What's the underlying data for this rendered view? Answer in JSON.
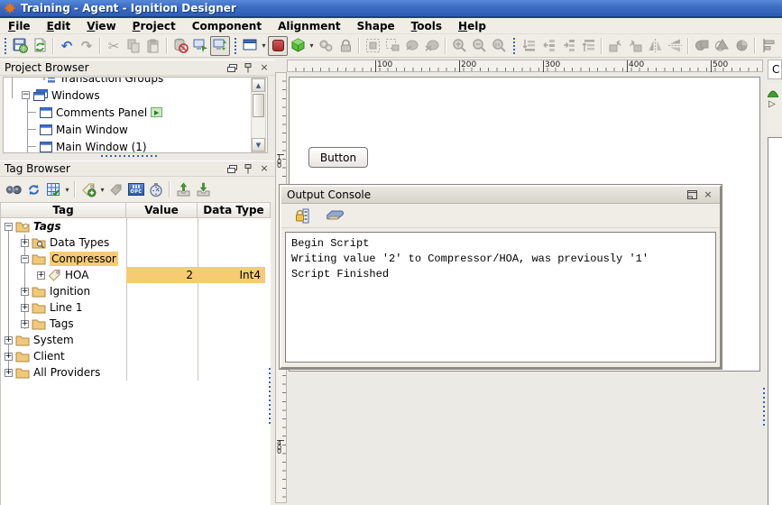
{
  "window": {
    "title": "Training - Agent - Ignition Designer"
  },
  "menu": {
    "items": [
      "File",
      "Edit",
      "View",
      "Project",
      "Component",
      "Alignment",
      "Shape",
      "Tools",
      "Help"
    ]
  },
  "project_browser": {
    "title": "Project Browser",
    "nodes": {
      "transaction_groups": "Transaction Groups",
      "windows": "Windows",
      "comments_panel": "Comments Panel",
      "main_window": "Main Window",
      "main_window_1": "Main Window (1)"
    }
  },
  "tag_browser": {
    "title": "Tag Browser",
    "columns": [
      "Tag",
      "Value",
      "Data Type"
    ],
    "opc_label": "OPC",
    "rows": [
      {
        "label": "Tags",
        "value": "",
        "type": ""
      },
      {
        "label": "Data Types",
        "value": "",
        "type": ""
      },
      {
        "label": "Compressor",
        "value": "",
        "type": ""
      },
      {
        "label": "HOA",
        "value": "2",
        "type": "Int4"
      },
      {
        "label": "Ignition",
        "value": "",
        "type": ""
      },
      {
        "label": "Line 1",
        "value": "",
        "type": ""
      },
      {
        "label": "Tags",
        "value": "",
        "type": ""
      },
      {
        "label": "System",
        "value": "",
        "type": ""
      },
      {
        "label": "Client",
        "value": "",
        "type": ""
      },
      {
        "label": "All Providers",
        "value": "",
        "type": ""
      }
    ]
  },
  "canvas": {
    "button_label": "Button",
    "h_ruler": [
      "100",
      "200",
      "300",
      "400",
      "500"
    ],
    "v_ruler": [
      "100",
      "400"
    ]
  },
  "output_console": {
    "title": "Output Console",
    "lines": [
      "Begin Script",
      "Writing value '2' to Compressor/HOA, was previously '1'",
      "Script Finished"
    ]
  },
  "right_panel": {
    "title": "C"
  },
  "colors": {
    "selection": "#F6CB72",
    "titlebar_blue": "#3D6CC4",
    "comm_red": "#A92C2C"
  },
  "icons": {
    "close": "×",
    "caret": "▾",
    "play": "▶",
    "up": "▲",
    "down": "▼",
    "plus": "+",
    "minus": "−",
    "undo": "↶",
    "redo": "↷",
    "cut": "✂",
    "tri": "▷",
    "arrow_up": "↑",
    "arrow_down": "↓"
  }
}
